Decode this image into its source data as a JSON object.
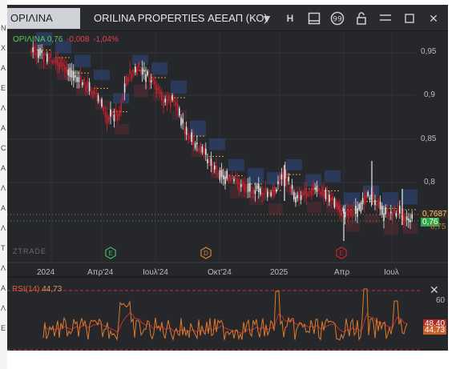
{
  "header": {
    "symbol": "ΟΡΙΛΙΝΑ",
    "title": "ORILINA PROPERTIES ΑΕΕΑΠ (ΚΟ)",
    "h_label": "H"
  },
  "legend": {
    "name": "ΟΡΙΛΙΝΑ",
    "price": "0,76",
    "change": "-0,008",
    "change_pct": "-1,04%"
  },
  "y_axis": [
    "0,95",
    "0,9",
    "0,85",
    "0,8"
  ],
  "x_axis": [
    "2024",
    "Απρ'24",
    "Ιουλ'24",
    "Οκτ'24",
    "2025",
    "Απρ",
    "Ιουλ"
  ],
  "event_markers": [
    "E",
    "D",
    "E"
  ],
  "watermark": "ZTRADE",
  "price_tags": {
    "prev": "0,7687",
    "last": "0,76",
    "low": "0,75"
  },
  "rsi": {
    "label": "RSI(14)",
    "value": "44,73",
    "level": "60",
    "tag_a": "48,40",
    "tag_b": "44,73"
  },
  "colors": {
    "background": "#26272b",
    "up": "#e8e8e8",
    "down": "#d0202f",
    "rsi_line": "#e07a2a",
    "rsi_ma": "#c0303a",
    "box": "#2f4a82"
  },
  "left_strip": [
    "N",
    "X",
    "A",
    "Ε",
    "Λ",
    "A",
    "C",
    "A",
    "Λ",
    "A",
    "Λ",
    "T",
    "Λ",
    "A",
    "Λ",
    "E"
  ]
}
